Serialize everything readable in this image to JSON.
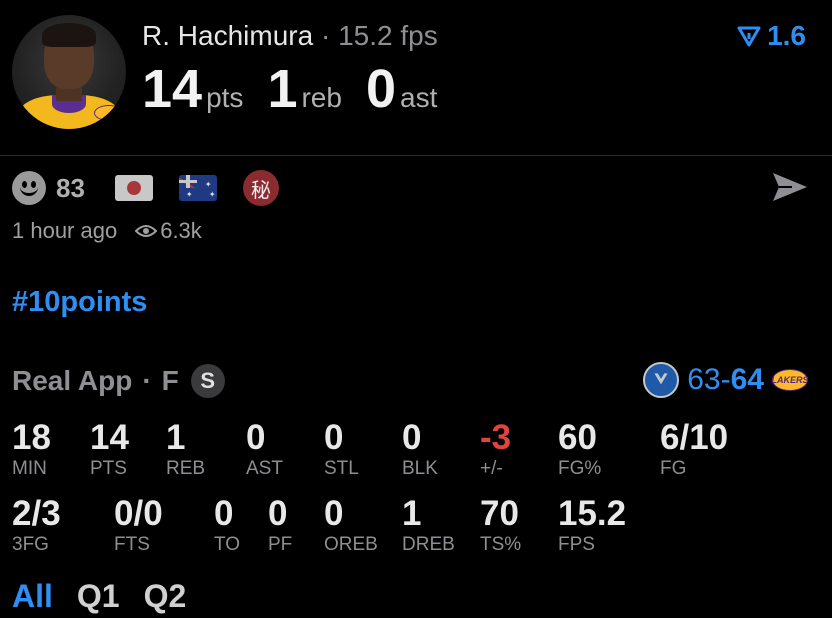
{
  "player": {
    "name": "R. Hachimura",
    "separator": "·",
    "fps": "15.2 fps",
    "pts": "14",
    "pts_label": "pts",
    "reb": "1",
    "reb_label": "reb",
    "ast": "0",
    "ast_label": "ast"
  },
  "rating": {
    "icon": "filter-v-icon",
    "value": "1.6",
    "color": "#2f8ef2"
  },
  "reactions": {
    "count": "83",
    "flags": [
      "japan-flag",
      "australia-flag"
    ],
    "badge": "秘"
  },
  "meta": {
    "time": "1 hour ago",
    "views": "6.3k"
  },
  "hashtag": "#10points",
  "game": {
    "source": "Real App",
    "separator": "·",
    "status": "F",
    "badge": "S",
    "away_score": "63",
    "dash": "-",
    "home_score": "64",
    "home_logo_text": "LAKERS"
  },
  "box_row1": [
    {
      "value": "18",
      "label": "MIN"
    },
    {
      "value": "14",
      "label": "PTS"
    },
    {
      "value": "1",
      "label": "REB"
    },
    {
      "value": "0",
      "label": "AST"
    },
    {
      "value": "0",
      "label": "STL"
    },
    {
      "value": "0",
      "label": "BLK"
    },
    {
      "value": "-3",
      "label": "+/-"
    },
    {
      "value": "60",
      "label": "FG%"
    },
    {
      "value": "6/10",
      "label": "FG"
    }
  ],
  "box_row2": [
    {
      "value": "2/3",
      "label": "3FG"
    },
    {
      "value": "0/0",
      "label": "FTS"
    },
    {
      "value": "0",
      "label": "TO"
    },
    {
      "value": "0",
      "label": "PF"
    },
    {
      "value": "0",
      "label": "OREB"
    },
    {
      "value": "1",
      "label": "DREB"
    },
    {
      "value": "70",
      "label": "TS%"
    },
    {
      "value": "15.2",
      "label": "FPS"
    }
  ],
  "periods": [
    "All",
    "Q1",
    "Q2"
  ],
  "colors": {
    "accent": "#2f8ef2",
    "negative": "#e0443e",
    "background": "#000000"
  }
}
